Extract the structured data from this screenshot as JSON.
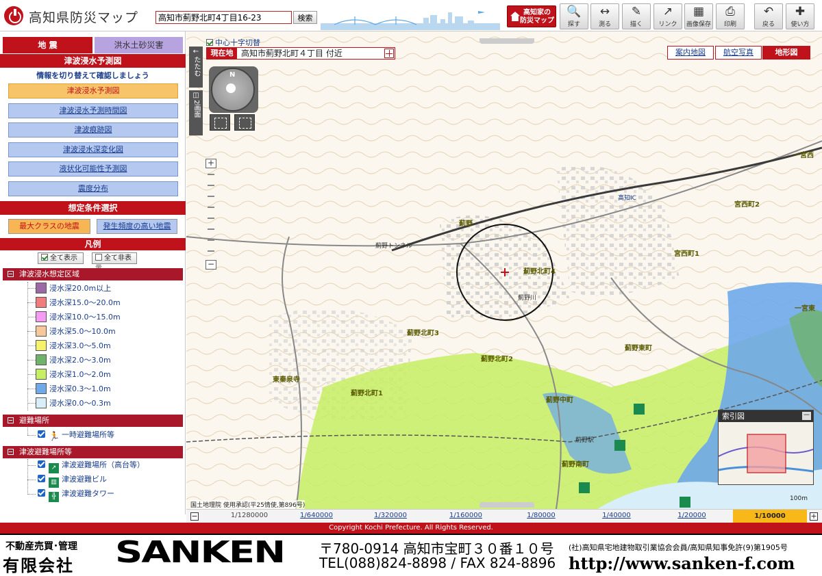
{
  "header": {
    "title": "高知県防災マップ",
    "search_value": "高知市薊野北町4丁目16-23",
    "search_button": "検索",
    "brand_button": [
      "高知家の",
      "防災マップ"
    ],
    "tools": [
      {
        "label": "探す",
        "icon": "🔍"
      },
      {
        "label": "測る",
        "icon": "↔"
      },
      {
        "label": "描く",
        "icon": "✎"
      },
      {
        "label": "リンク",
        "icon": "↗"
      },
      {
        "label": "画像保存",
        "icon": "▦"
      },
      {
        "label": "印刷",
        "icon": "⎙"
      },
      {
        "label": "戻る",
        "icon": "↶"
      },
      {
        "label": "使い方",
        "icon": "✚"
      }
    ]
  },
  "left": {
    "tabs": {
      "quake": "地 震",
      "flood": "洪水土砂災害"
    },
    "section_title": "津波浸水予測図",
    "info_text": "情報を切り替えて確認しましょう",
    "menu": [
      "津波浸水予測図",
      "津波浸水予測時間図",
      "津波痕跡図",
      "津波浸水深変化図",
      "液状化可能性予測図",
      "震度分布"
    ],
    "condition_title": "想定条件選択",
    "conditions": {
      "max": "最大クラスの地震",
      "freq": "発生頻度の高い地震"
    },
    "legend_title": "凡例",
    "show_all": "全て表示",
    "hide_all": "全て非表示",
    "group_inundation": "津波浸水想定区域",
    "inundation": [
      {
        "label": "浸水深20.0m以上",
        "color": "#9b69a6"
      },
      {
        "label": "浸水深15.0～20.0m",
        "color": "#f27b7b"
      },
      {
        "label": "浸水深10.0～15.0m",
        "color": "#f59bf3"
      },
      {
        "label": "浸水深5.0～10.0m",
        "color": "#f7c99a"
      },
      {
        "label": "浸水深3.0～5.0m",
        "color": "#f7f26b"
      },
      {
        "label": "浸水深2.0～3.0m",
        "color": "#6fb36b"
      },
      {
        "label": "浸水深1.0～2.0m",
        "color": "#c6ef63"
      },
      {
        "label": "浸水深0.3～1.0m",
        "color": "#6ea9ea"
      },
      {
        "label": "浸水深0.0～0.3m",
        "color": "#d8eef9"
      }
    ],
    "group_evac": "避難場所",
    "evac": [
      "一時避難場所等"
    ],
    "group_tsunami": "津波避難場所等",
    "tsunami": [
      "津波避難場所（高台等）",
      "津波避難ビル",
      "津波避難タワー"
    ]
  },
  "map": {
    "strip_fold": "たたむ",
    "strip_dual": "2画面",
    "center_toggle": "中心十字切替",
    "location_label": "現在地",
    "location_text": "高知市薊野北町４丁目 付近",
    "maptypes": [
      "案内地図",
      "航空写真",
      "地形図"
    ],
    "compass_n": "N",
    "place_labels": [
      "薊野",
      "薊野北町4",
      "薊野北町3",
      "薊野北町2",
      "薊野北町1",
      "薊野東町",
      "薊野中町",
      "薊野南町",
      "宮西町2",
      "宮西町1",
      "一宮西",
      "一宮東",
      "東秦泉寺",
      "薊野トンネル",
      "高知IC",
      "薊野駅",
      "薊野川"
    ],
    "index_title": "索引図",
    "index_minimize": "－",
    "scale_label": "100m",
    "attribution": "国土地理院 使用承認(平25情使,第896号)"
  },
  "scalebar": [
    "1/1280000",
    "1/640000",
    "1/320000",
    "1/160000",
    "1/80000",
    "1/40000",
    "1/20000",
    "1/10000"
  ],
  "scalebar_current": "1/10000",
  "copyright": "Copyright Kochi Prefecture. All Rights Reserved.",
  "banner": {
    "tag1": "不動産売買･管理",
    "tag2": "有限会社",
    "name": "SANKEN",
    "address": "〒780-0914 高知市宝町３０番１０号",
    "tel": "TEL(088)824-8898 / FAX 824-8896",
    "member": "(社)高知県宅地建物取引業協会会員/高知県知事免許(9)第1905号",
    "url": "http://www.sanken-f.com"
  },
  "colors": {
    "brand_red": "#c0121b",
    "link_blue": "#1a3d8c",
    "map_bg": "#fbf7ef"
  }
}
